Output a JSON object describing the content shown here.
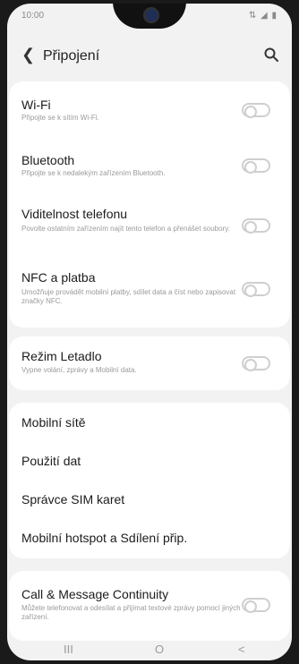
{
  "status_bar": {
    "time": "10:00",
    "indicators": "⇅ ◢ ▮"
  },
  "header": {
    "back_icon": "chevron-left",
    "title": "Připojení",
    "search_icon": "search"
  },
  "group1": [
    {
      "label": "Wi-Fi",
      "desc": "Připojte se k sítím Wi-Fi.",
      "toggle": false
    },
    {
      "label": "Bluetooth",
      "desc": "Připojte se k nedalekým zařízením Bluetooth.",
      "toggle": false
    },
    {
      "label": "Viditelnost telefonu",
      "desc": "Povolte ostatním zařízením najít tento telefon a přenášet soubory.",
      "toggle": false
    },
    {
      "label": "NFC a platba",
      "desc": "Umožňuje provádět mobilní platby, sdílet data a číst nebo zapisovat značky NFC.",
      "toggle": false
    }
  ],
  "group2": [
    {
      "label": "Režim Letadlo",
      "desc": "Vypne volání, zprávy a Mobilní data.",
      "toggle": false
    }
  ],
  "group3": [
    {
      "label": "Mobilní sítě"
    },
    {
      "label": "Použití dat"
    },
    {
      "label": "Správce SIM karet"
    },
    {
      "label": "Mobilní hotspot a Sdílení přip."
    }
  ],
  "group4": [
    {
      "label": "Call & Message Continuity",
      "desc": "Můžete telefonovat a odesílat a přijímat textové zprávy pomocí jiných zařízení.",
      "toggle": false
    }
  ],
  "nav": {
    "recents": "III",
    "home": "O",
    "back": "<"
  }
}
